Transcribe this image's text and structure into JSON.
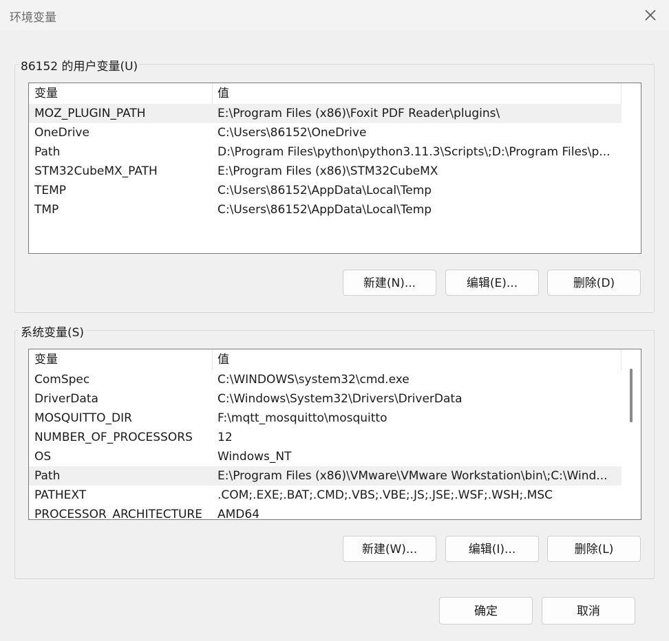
{
  "window": {
    "title": "环境变量"
  },
  "user_group": {
    "label": "86152 的用户变量(U)",
    "columns": [
      "变量",
      "值"
    ],
    "rows": [
      [
        "MOZ_PLUGIN_PATH",
        "E:\\Program Files (x86)\\Foxit PDF Reader\\plugins\\"
      ],
      [
        "OneDrive",
        "C:\\Users\\86152\\OneDrive"
      ],
      [
        "Path",
        "D:\\Program Files\\python\\python3.11.3\\Scripts\\;D:\\Program Files\\p..."
      ],
      [
        "STM32CubeMX_PATH",
        "E:\\Program Files (x86)\\STM32CubeMX"
      ],
      [
        "TEMP",
        "C:\\Users\\86152\\AppData\\Local\\Temp"
      ],
      [
        "TMP",
        "C:\\Users\\86152\\AppData\\Local\\Temp"
      ]
    ],
    "buttons": {
      "new": "新建(N)...",
      "edit": "编辑(E)...",
      "delete": "删除(D)"
    }
  },
  "system_group": {
    "label": "系统变量(S)",
    "columns": [
      "变量",
      "值"
    ],
    "rows": [
      [
        "ComSpec",
        "C:\\WINDOWS\\system32\\cmd.exe"
      ],
      [
        "DriverData",
        "C:\\Windows\\System32\\Drivers\\DriverData"
      ],
      [
        "MOSQUITTO_DIR",
        "F:\\mqtt_mosquitto\\mosquitto"
      ],
      [
        "NUMBER_OF_PROCESSORS",
        "12"
      ],
      [
        "OS",
        "Windows_NT"
      ],
      [
        "Path",
        "E:\\Program Files (x86)\\VMware\\VMware Workstation\\bin\\;C:\\Wind..."
      ],
      [
        "PATHEXT",
        ".COM;.EXE;.BAT;.CMD;.VBS;.VBE;.JS;.JSE;.WSF;.WSH;.MSC"
      ],
      [
        "PROCESSOR_ARCHITECTURE",
        "AMD64"
      ]
    ],
    "buttons": {
      "new": "新建(W)...",
      "edit": "编辑(I)...",
      "delete": "删除(L)"
    }
  },
  "footer": {
    "ok": "确定",
    "cancel": "取消"
  }
}
